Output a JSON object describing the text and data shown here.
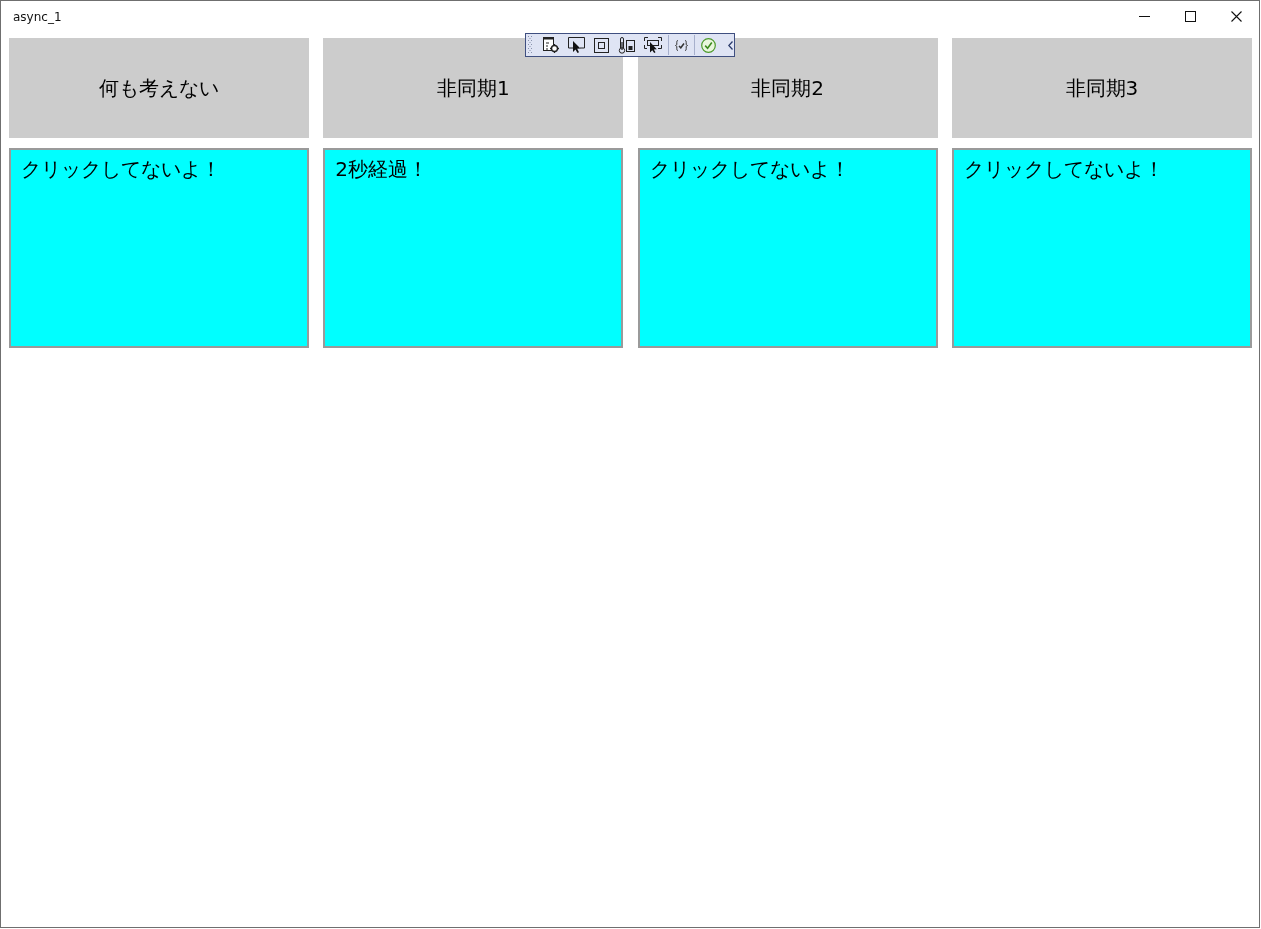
{
  "window": {
    "title": "async_1"
  },
  "panels": [
    {
      "button": "何も考えない",
      "text_box": "クリックしてないよ！"
    },
    {
      "button": "非同期1",
      "text_box": "2秒経過！"
    },
    {
      "button": "非同期2",
      "text_box": "クリックしてないよ！"
    },
    {
      "button": "非同期3",
      "text_box": "クリックしてないよ！"
    }
  ]
}
